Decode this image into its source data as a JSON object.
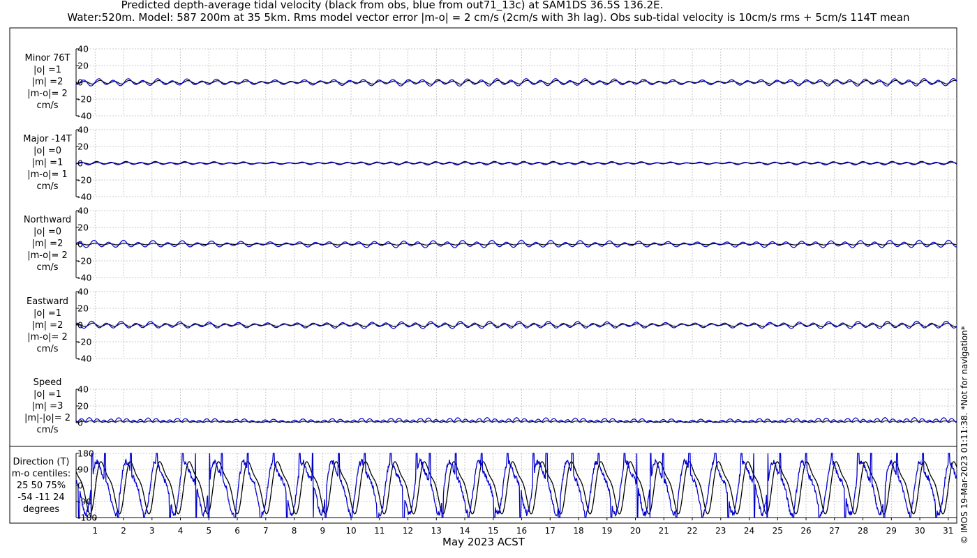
{
  "title_line1": "Predicted depth-average tidal velocity (black from obs, blue from out71_13c) at SAM1DS 36.5S 136.2E.",
  "title_line2": "Water:520m. Model: 587 200m at 35 5km. Rms model vector error |m-o| = 2 cm/s (2cm/s with 3h lag). Obs sub-tidal velocity is 10cm/s rms + 5cm/s 114T mean",
  "credit": "© IMOS 19-Mar-2023 01:11:38. *Not for navigation*",
  "panels": [
    {
      "label_lines": [
        "Minor 76T",
        "|o| =1",
        "|m| =2",
        "|m-o|= 2",
        "cm/s"
      ]
    },
    {
      "label_lines": [
        "Major -14T",
        "|o| =0",
        "|m| =1",
        "|m-o|= 1",
        "cm/s"
      ]
    },
    {
      "label_lines": [
        "Northward",
        "|o| =0",
        "|m| =2",
        "|m-o|= 2",
        "cm/s"
      ]
    },
    {
      "label_lines": [
        "Eastward",
        "|o| =1",
        "|m| =2",
        "|m-o|= 2",
        "cm/s"
      ]
    },
    {
      "label_lines": [
        "Speed",
        "|o| =1",
        "|m| =3",
        "|m|-|o|= 2",
        "cm/s"
      ]
    },
    {
      "label_lines": [
        "Direction (T)",
        "m-o centiles:",
        "25  50  75%",
        "-54  -11  24",
        "degrees"
      ]
    }
  ],
  "chart_data": {
    "type": "line",
    "xlabel": "May 2023 ACST",
    "x_ticks": [
      1,
      2,
      3,
      4,
      5,
      6,
      7,
      8,
      9,
      10,
      11,
      12,
      13,
      14,
      15,
      16,
      17,
      18,
      19,
      20,
      21,
      22,
      23,
      24,
      25,
      26,
      27,
      28,
      29,
      30,
      31
    ],
    "x_range_days": [
      0.33,
      31.3
    ],
    "series_colors": {
      "obs": "#000000",
      "model": "#0000cc"
    },
    "grid": true,
    "subplots": [
      {
        "name": "Minor 76T",
        "ylim": [
          -40,
          40
        ],
        "yticks": [
          40,
          20,
          0,
          -20,
          -40
        ],
        "obs_amplitude": 1,
        "model_amplitude": 2
      },
      {
        "name": "Major -14T",
        "ylim": [
          -40,
          40
        ],
        "yticks": [
          40,
          20,
          0,
          -20,
          -40
        ],
        "obs_amplitude": 0.5,
        "model_amplitude": 1
      },
      {
        "name": "Northward",
        "ylim": [
          -40,
          40
        ],
        "yticks": [
          40,
          20,
          0,
          -20,
          -40
        ],
        "obs_amplitude": 0.5,
        "model_amplitude": 2
      },
      {
        "name": "Eastward",
        "ylim": [
          -40,
          40
        ],
        "yticks": [
          40,
          20,
          0,
          -20,
          -40
        ],
        "obs_amplitude": 1,
        "model_amplitude": 2
      },
      {
        "name": "Speed",
        "ylim": [
          0,
          40
        ],
        "yticks": [
          40,
          20,
          0
        ],
        "obs_amplitude": 1,
        "model_amplitude": 3
      },
      {
        "name": "Direction (T)",
        "ylim": [
          -180,
          180
        ],
        "yticks": [
          180,
          90,
          0,
          -90,
          -180
        ]
      }
    ]
  }
}
